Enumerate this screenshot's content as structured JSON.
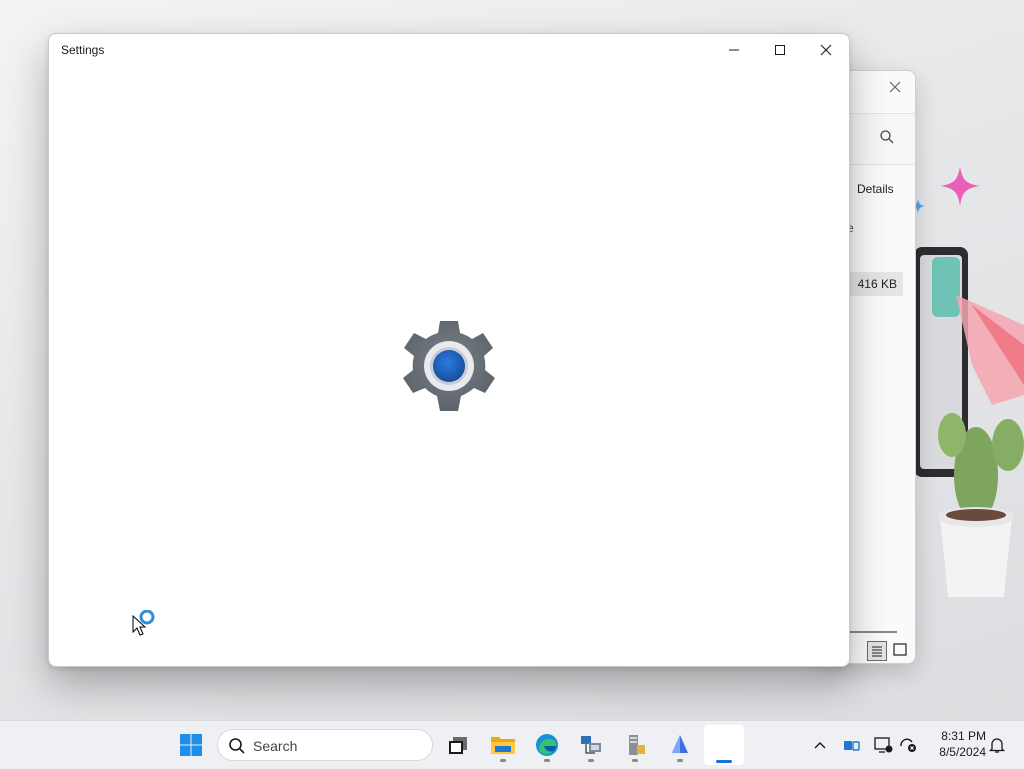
{
  "settings_window": {
    "title": "Settings",
    "icons": {
      "minimize": "minimize-icon",
      "maximize": "maximize-icon",
      "close": "close-icon",
      "splash": "settings-gear-icon"
    },
    "colors": {
      "gear": "#6b7178",
      "accent": "#1e5fb4"
    }
  },
  "background_window": {
    "details_label": "Details",
    "partial_text": "e",
    "file_size": "416 KB",
    "icons": {
      "close": "close-icon",
      "search": "search-icon",
      "details_view": "details-view-icon",
      "tiles_view": "large-icons-view-icon"
    }
  },
  "taskbar": {
    "search_placeholder": "Search",
    "apps": [
      {
        "name": "start-button",
        "icon": "windows-logo-icon"
      },
      {
        "name": "task-view-button",
        "icon": "task-view-icon"
      },
      {
        "name": "file-explorer-button",
        "icon": "folder-icon"
      },
      {
        "name": "edge-button",
        "icon": "edge-icon"
      },
      {
        "name": "network-app-button",
        "icon": "network-computer-icon"
      },
      {
        "name": "server-app-button",
        "icon": "server-icon"
      },
      {
        "name": "sail-app-button",
        "icon": "sail-icon"
      },
      {
        "name": "settings-taskbar-button",
        "icon": "settings-icon",
        "active": true
      }
    ],
    "tray": {
      "icons": [
        "chevron-up-icon",
        "bluetooth-devices-icon",
        "network-monitor-icon",
        "sync-error-icon",
        "notification-icon"
      ]
    },
    "clock": {
      "time": "8:31 PM",
      "date": "8/5/2024"
    }
  }
}
